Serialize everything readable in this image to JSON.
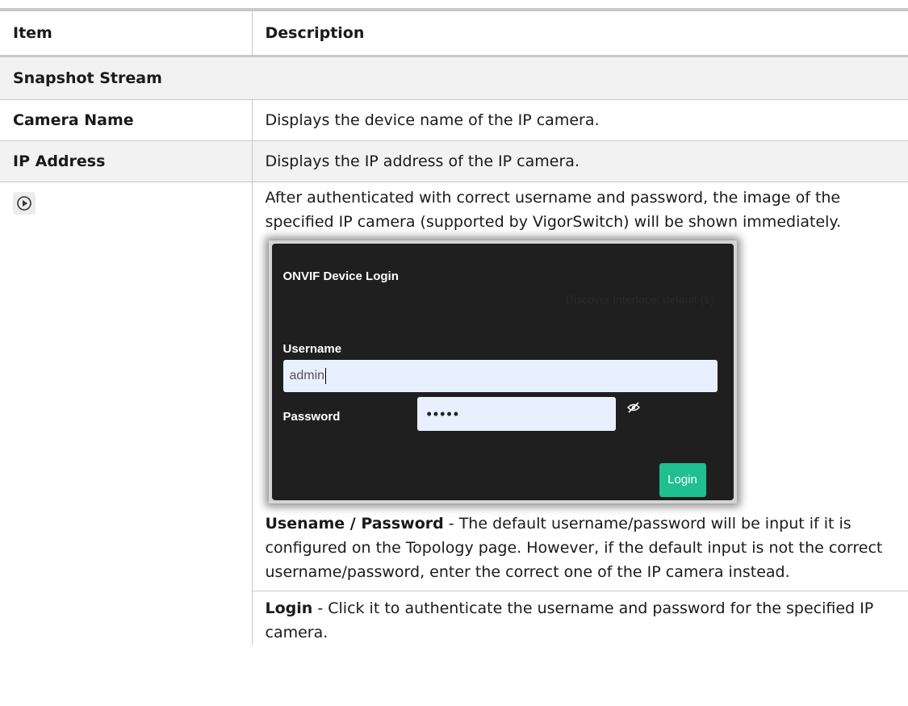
{
  "header": {
    "item": "Item",
    "description": "Description"
  },
  "section": {
    "title": "Snapshot Stream"
  },
  "rows": [
    {
      "item": "Camera Name",
      "description": "Displays the device name of the IP camera."
    },
    {
      "item": "IP Address",
      "description": "Displays the IP address of the IP camera."
    }
  ],
  "play_row": {
    "icon": "play-circle-icon",
    "intro": "After authenticated with correct username and password, the image of the specified IP camera (supported by VigorSwitch) will be shown immediately.",
    "dialog": {
      "title": "ONVIF Device Login",
      "ghost_text": "Discover Interface:   default (1)",
      "username_label": "Username",
      "username_value": "admin",
      "password_label": "Password",
      "password_value": "•••••",
      "password_toggle_icon": "eye-slash-icon",
      "login_label": "Login",
      "login_color": "#1fbf8f"
    },
    "note1_term": "Usename / Password",
    "note1_text": " - The default username/password will be input if it is configured on the Topology page. However, if the default input is not the correct username/password, enter the correct one of the IP camera instead.",
    "note2_term": "Login",
    "note2_text": " - Click it to authenticate the username and password for the specified IP camera."
  }
}
